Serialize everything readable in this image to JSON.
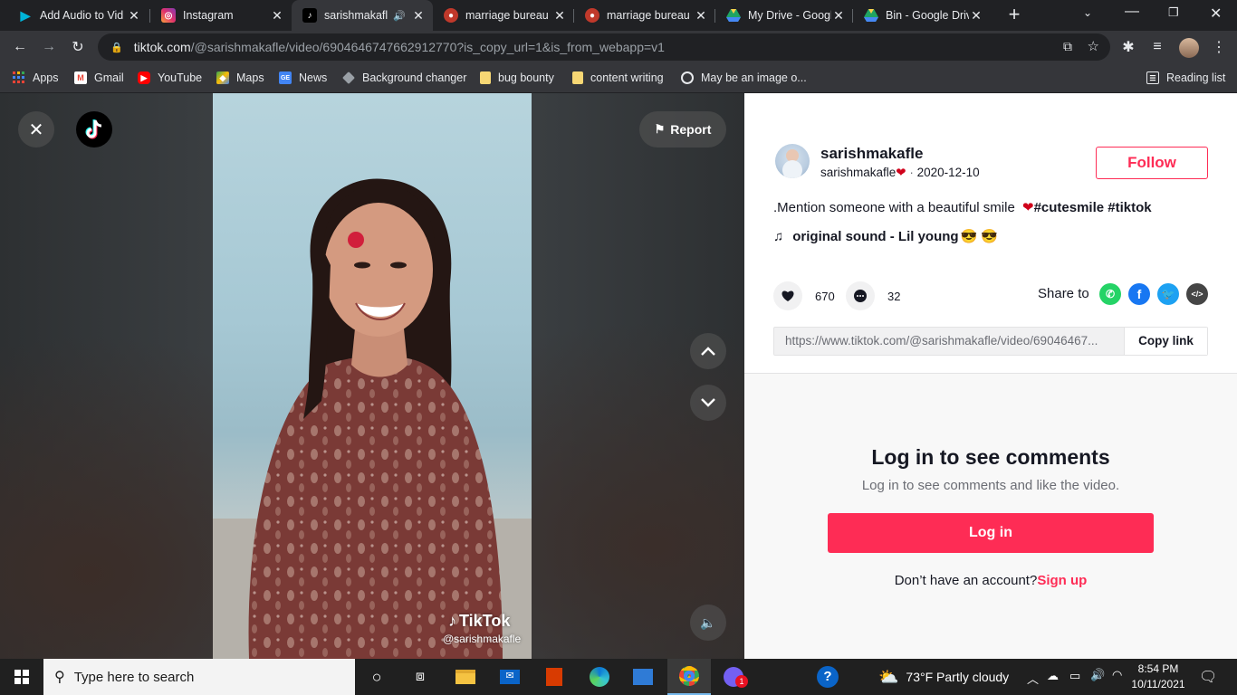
{
  "browser": {
    "tabs": [
      {
        "title": "Add Audio to Vid",
        "favicon": "play-logo",
        "color": "#00b4d8"
      },
      {
        "title": "Instagram",
        "favicon": "instagram-logo",
        "color": "#e1306c"
      },
      {
        "title": "sarishmakafle",
        "favicon": "tiktok-logo",
        "color": "#000000",
        "active": true,
        "audio": true
      },
      {
        "title": "marriage bureau",
        "favicon": "bureau-logo",
        "color": "#c0392b"
      },
      {
        "title": "marriage bureau",
        "favicon": "bureau-logo",
        "color": "#c0392b"
      },
      {
        "title": "My Drive - Googl",
        "favicon": "drive-logo",
        "color": "#1fa463"
      },
      {
        "title": "Bin - Google Driv",
        "favicon": "drive-logo",
        "color": "#1fa463"
      }
    ],
    "new_tab": "+",
    "url_host": "tiktok.com",
    "url_rest": "/@sarishmakafle/video/6904646747662912770?is_copy_url=1&is_from_webapp=v1",
    "bookmarks": [
      {
        "label": "Apps",
        "icon": "apps-grid-icon"
      },
      {
        "label": "Gmail",
        "icon": "gmail-icon"
      },
      {
        "label": "YouTube",
        "icon": "youtube-icon"
      },
      {
        "label": "Maps",
        "icon": "maps-icon"
      },
      {
        "label": "News",
        "icon": "news-icon"
      },
      {
        "label": "Background changer",
        "icon": "layers-icon"
      },
      {
        "label": "bug bounty",
        "icon": "folder-icon"
      },
      {
        "label": "content writing",
        "icon": "folder-icon"
      },
      {
        "label": "May be an image o...",
        "icon": "globe-icon"
      }
    ],
    "reading_list": "Reading list"
  },
  "video": {
    "report_label": "Report",
    "watermark_brand": "TikTok",
    "watermark_user": "@sarishmakafle"
  },
  "panel": {
    "username": "sarishmakafle",
    "nickname": "sarishmakafle",
    "date": "2020-12-10",
    "follow_label": "Follow",
    "description": ".Mention someone with a beautiful smile",
    "hashtags": "#cutesmile #tiktok",
    "music": "original sound - Lil young",
    "likes": "670",
    "comments": "32",
    "share_label": "Share to",
    "link": "https://www.tiktok.com/@sarishmakafle/video/69046467...",
    "copy_link_label": "Copy link",
    "login_title": "Log in to see comments",
    "login_sub": "Log in to see comments and like the video.",
    "login_button": "Log in",
    "no_account": "Don’t have an account?",
    "signup": "Sign up",
    "accent": "#fe2c55"
  },
  "taskbar": {
    "search_placeholder": "Type here to search",
    "weather": "73°F  Partly cloudy",
    "time": "8:54 PM",
    "date": "10/11/2021",
    "notification_count": "1"
  }
}
